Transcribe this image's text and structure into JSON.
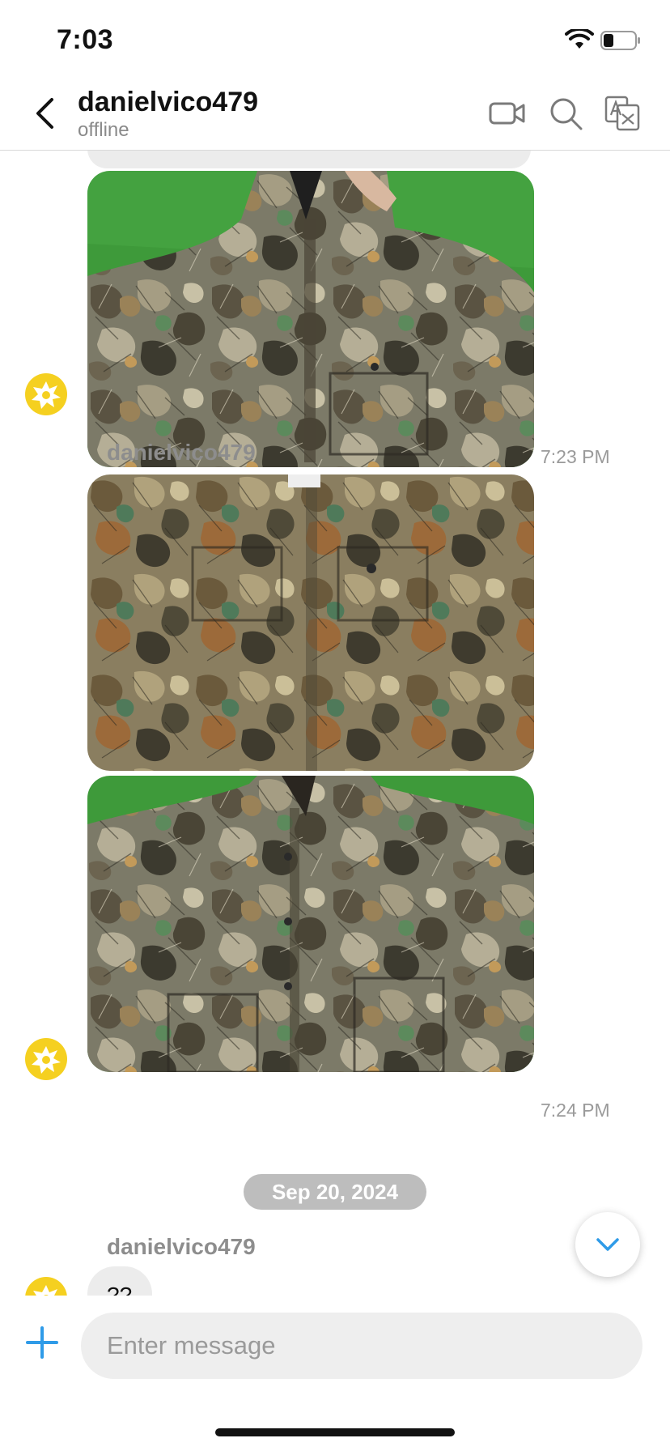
{
  "status_bar": {
    "time": "7:03",
    "icons": [
      "wifi-icon",
      "battery-icon"
    ]
  },
  "header": {
    "contact_name": "danielvico479",
    "contact_status": "offline",
    "icons": [
      "back-arrow-icon",
      "video-camera-icon",
      "search-icon",
      "translate-icon"
    ]
  },
  "messages": [
    {
      "type": "image",
      "content": "camouflage jacket photo on grass",
      "time": "7:23 PM"
    },
    {
      "type": "image",
      "sender": "danielvico479",
      "content": "camouflage jacket close-up photo"
    },
    {
      "type": "image",
      "content": "camouflage hooded jacket photo on grass",
      "time": "7:24 PM"
    },
    {
      "type": "date_separator",
      "label": "Sep 20, 2024"
    },
    {
      "type": "text",
      "sender": "danielvico479",
      "text": "??"
    }
  ],
  "composer": {
    "placeholder": "Enter message",
    "icons": [
      "plus-icon"
    ]
  },
  "scroll_button": {
    "icon": "chevron-down-icon"
  },
  "colors": {
    "accent": "#2f9be8",
    "avatar": "#f5d020",
    "bubble": "#ececec",
    "date_pill": "#bdbdbd",
    "muted_text": "#8d8d8d"
  }
}
